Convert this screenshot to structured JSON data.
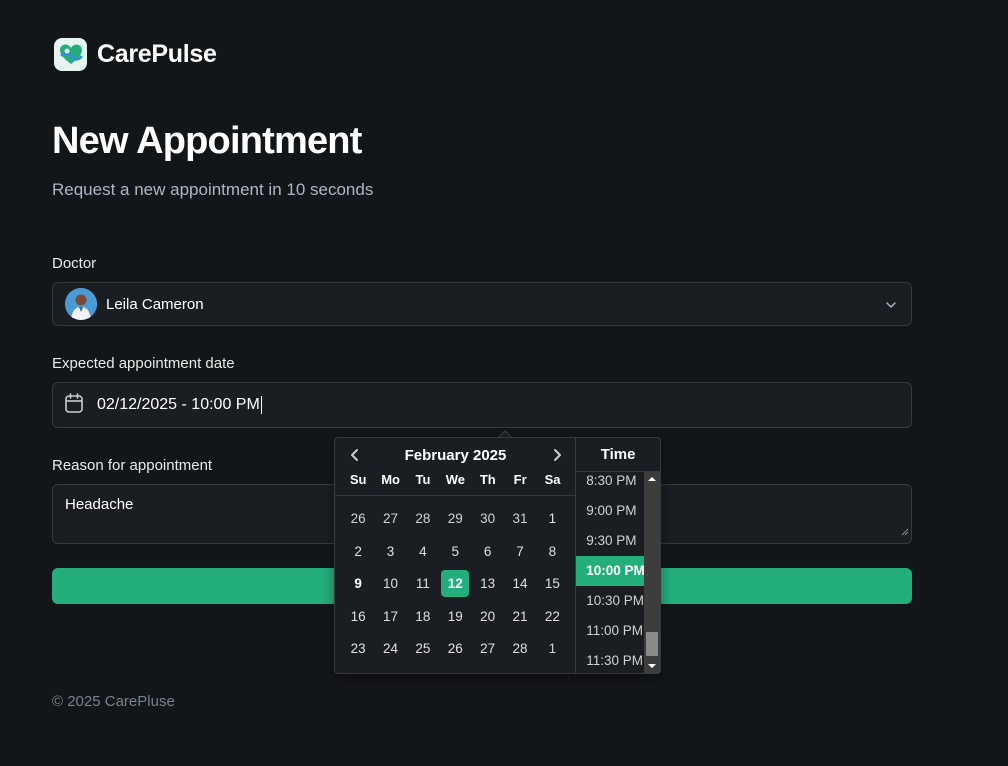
{
  "brand": {
    "name": "CarePulse"
  },
  "page": {
    "title": "New Appointment",
    "subtitle": "Request a new appointment in 10 seconds"
  },
  "form": {
    "doctor_label": "Doctor",
    "doctor_value": "Leila Cameron",
    "date_label": "Expected appointment date",
    "date_value": "02/12/2025 - 10:00 PM",
    "reason_label": "Reason for appointment",
    "reason_value": "Headache"
  },
  "datepicker": {
    "month_label": "February 2025",
    "weekdays": [
      "Su",
      "Mo",
      "Tu",
      "We",
      "Th",
      "Fr",
      "Sa"
    ],
    "weeks": [
      [
        "26",
        "27",
        "28",
        "29",
        "30",
        "31",
        "1"
      ],
      [
        "2",
        "3",
        "4",
        "5",
        "6",
        "7",
        "8"
      ],
      [
        "9",
        "10",
        "11",
        "12",
        "13",
        "14",
        "15"
      ],
      [
        "16",
        "17",
        "18",
        "19",
        "20",
        "21",
        "22"
      ],
      [
        "23",
        "24",
        "25",
        "26",
        "27",
        "28",
        "1"
      ]
    ],
    "selected_day": "12",
    "time_header": "Time",
    "times": [
      "8:30 PM",
      "9:00 PM",
      "9:30 PM",
      "10:00 PM",
      "10:30 PM",
      "11:00 PM",
      "11:30 PM"
    ],
    "selected_time": "10:00 PM"
  },
  "footer": {
    "copyright": "© 2025 CarePluse"
  },
  "colors": {
    "background": "#131619",
    "accent": "#24ae7c",
    "input_bg": "#1a1d21",
    "border": "#363a3d",
    "muted_text": "#abb8c4"
  },
  "icons": {
    "logo": "carepulse-logo-icon",
    "select_chevron": "chevron-down-icon",
    "date_field": "calendar-icon",
    "prev_month": "chevron-left-icon",
    "next_month": "chevron-right-icon"
  }
}
